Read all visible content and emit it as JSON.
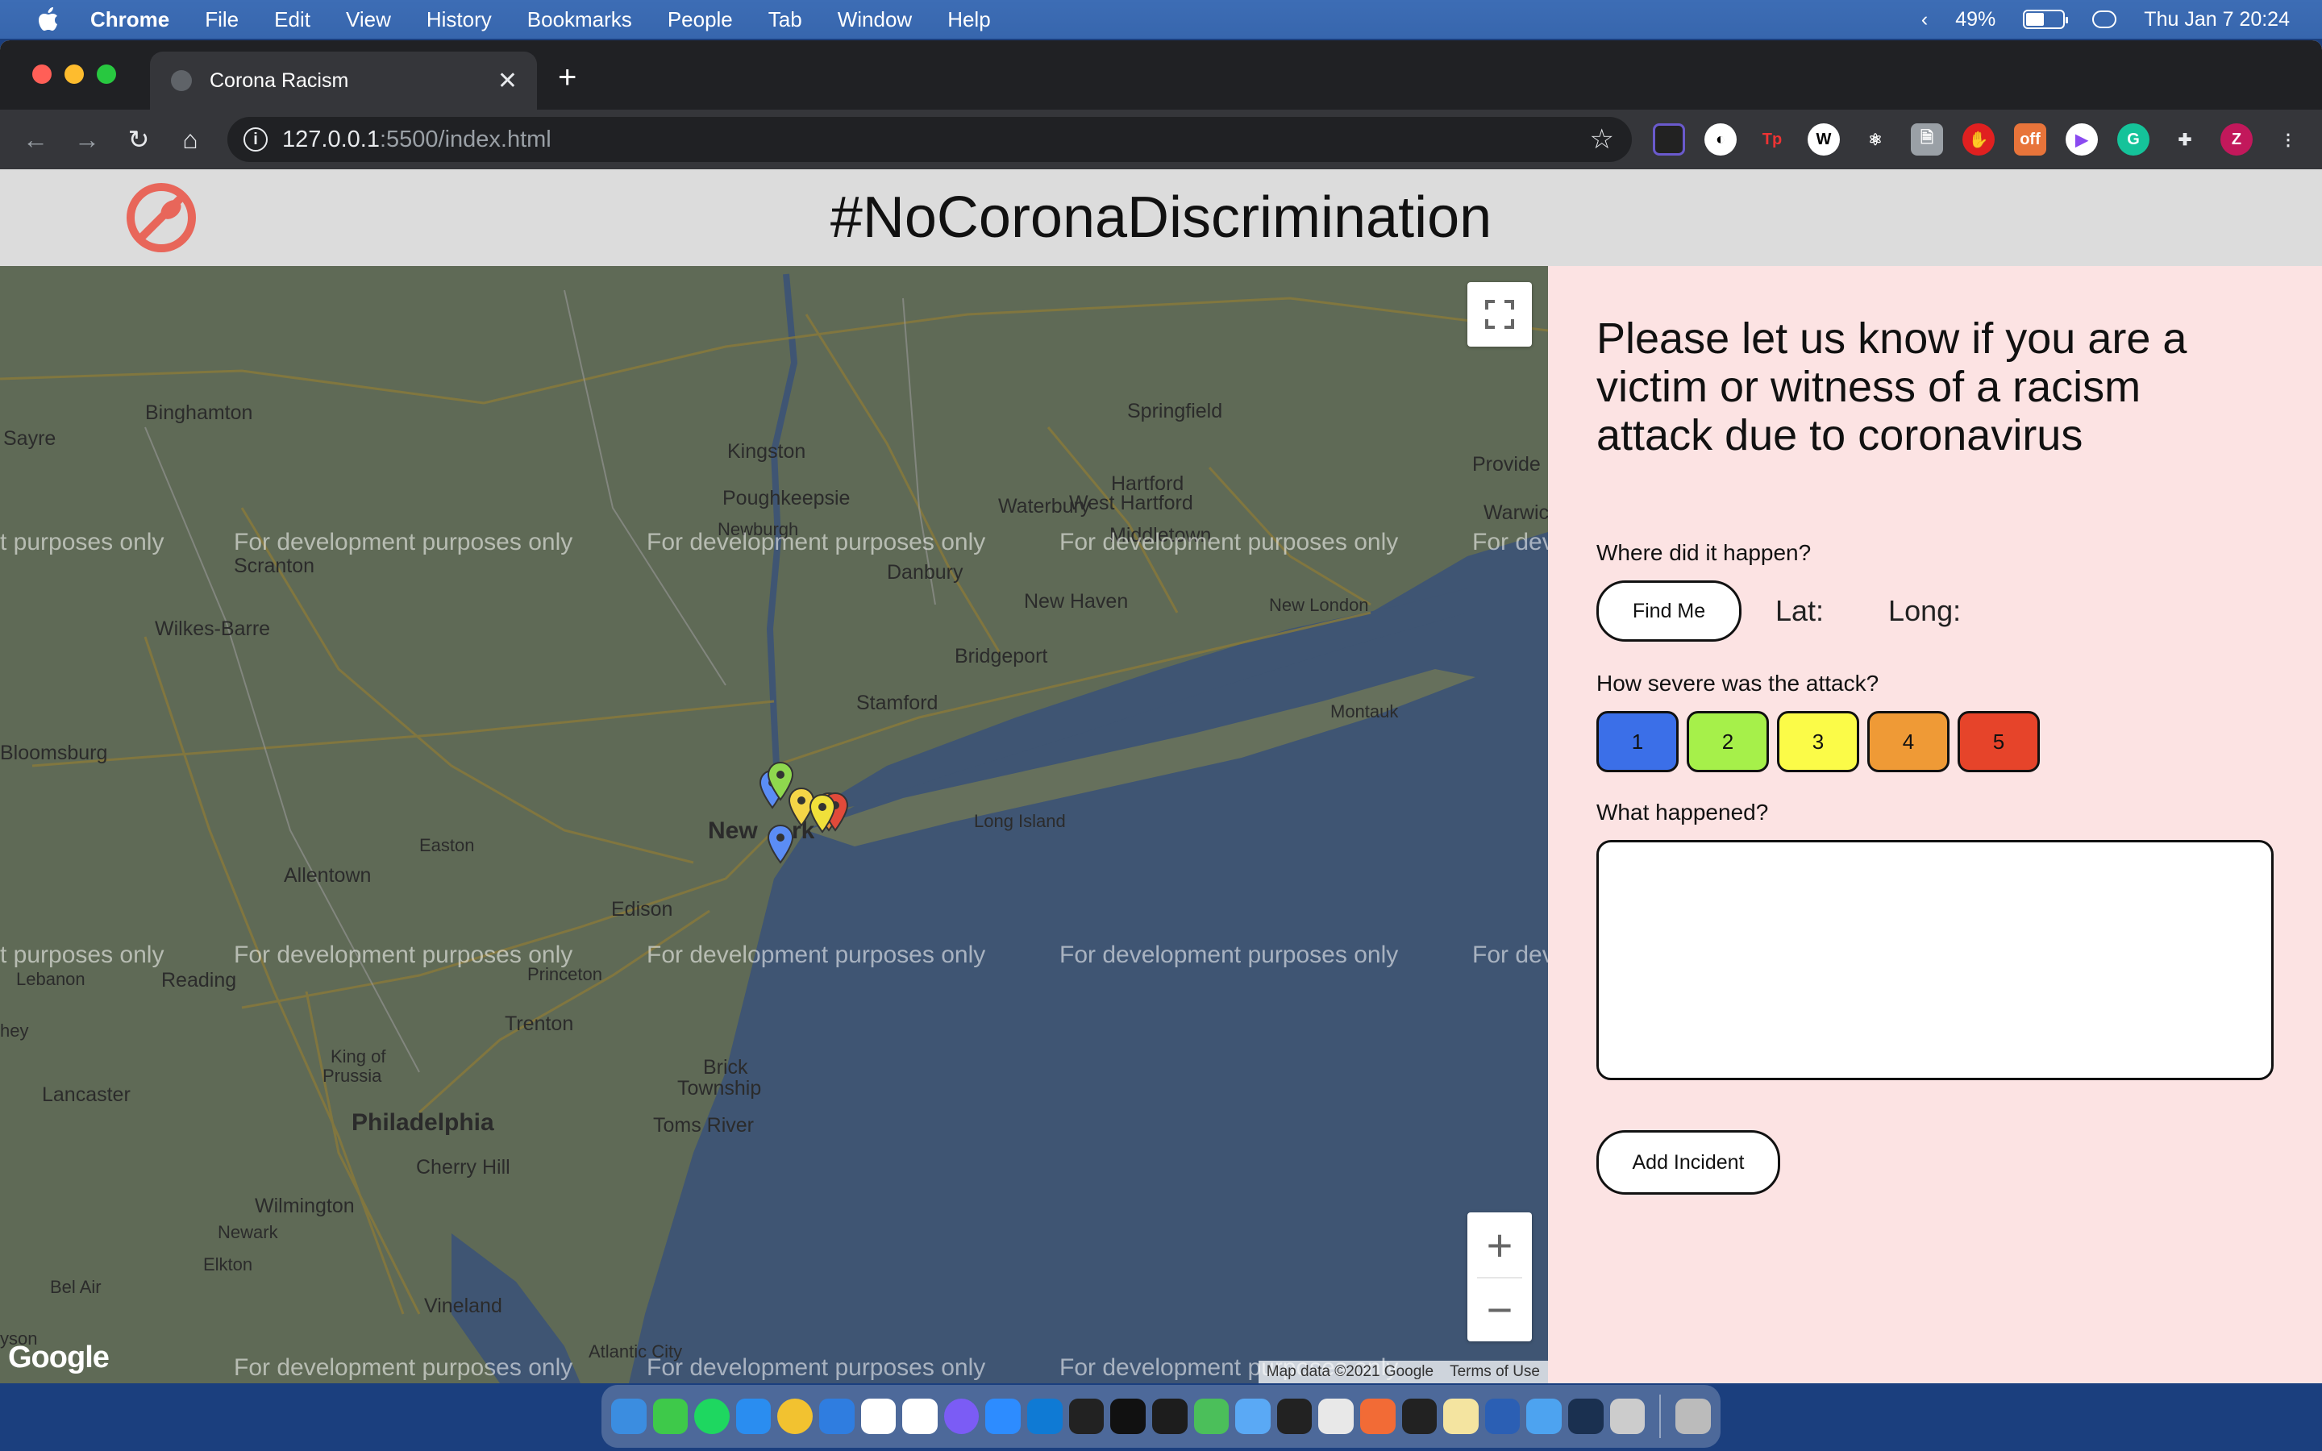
{
  "menubar": {
    "app_name": "Chrome",
    "items": [
      "File",
      "Edit",
      "View",
      "History",
      "Bookmarks",
      "People",
      "Tab",
      "Window",
      "Help"
    ],
    "battery": "49%",
    "clock": "Thu Jan 7  20:24"
  },
  "browser": {
    "tab_title": "Corona Racism",
    "url_host": "127.0.0.1",
    "url_rest": ":5500/index.html"
  },
  "header": {
    "title": "#NoCoronaDiscrimination"
  },
  "map": {
    "watermark": "For development purposes only",
    "watermark_partial_left": "t purposes only",
    "watermark_partial_right": "For dev",
    "attribution": "Map data ©2021 Google",
    "terms": "Terms of Use",
    "logo_text": "Google",
    "places": {
      "binghamton": "Binghamton",
      "sayre": "Sayre",
      "kingston": "Kingston",
      "springfield": "Springfield",
      "hartford": "Hartford",
      "west_hartford": "West Hartford",
      "providence": "Provide",
      "warwick": "Warwic",
      "poughkeepsie": "Poughkeepsie",
      "newburgh": "Newburgh",
      "waterbury": "Waterbury",
      "middletown": "Middletown",
      "scranton": "Scranton",
      "danbury": "Danbury",
      "new_haven": "New Haven",
      "new_london": "New London",
      "wilkes_barre": "Wilkes-Barre",
      "bridgeport": "Bridgeport",
      "stamford": "Stamford",
      "montauk": "Montauk",
      "bloomsburg": "Bloomsburg",
      "new_york_a": "New",
      "new_york_b": "rk",
      "long_island": "Long Island",
      "easton": "Easton",
      "allentown": "Allentown",
      "edison": "Edison",
      "lebanon": "Lebanon",
      "reading": "Reading",
      "princeton": "Princeton",
      "trenton": "Trenton",
      "king_of_prussia_1": "King of",
      "king_of_prussia_2": "Prussia",
      "brick_1": "Brick",
      "brick_2": "Township",
      "lancaster": "Lancaster",
      "philadelphia": "Philadelphia",
      "toms_river": "Toms River",
      "cherry_hill": "Cherry Hill",
      "wilmington": "Wilmington",
      "newark_de": "Newark",
      "elkton": "Elkton",
      "bel_air": "Bel Air",
      "vineland": "Vineland",
      "atlantic_city": "Atlantic City",
      "hey": "hey",
      "yson": "yson"
    },
    "pins": [
      "#5b8df5",
      "#8fd84e",
      "#f5d547",
      "#f0e03a",
      "#e8943a",
      "#e14a3a",
      "#5b8df5"
    ]
  },
  "form": {
    "heading": "Please let us know if you are a victim or witness of a racism attack due to coronavirus",
    "where_label": "Where did it happen?",
    "find_me": "Find Me",
    "lat_label": "Lat:",
    "long_label": "Long:",
    "severity_label": "How severe was the attack?",
    "severity_levels": [
      {
        "label": "1",
        "color": "#3b6fe8"
      },
      {
        "label": "2",
        "color": "#a6f04a"
      },
      {
        "label": "3",
        "color": "#fbfb48"
      },
      {
        "label": "4",
        "color": "#ef9a36"
      },
      {
        "label": "5",
        "color": "#e6442a"
      }
    ],
    "what_label": "What happened?",
    "description_value": "",
    "add_incident": "Add Incident"
  },
  "colors": {
    "panel_bg": "#fce3e3",
    "header_bg": "#dcdcdc",
    "logo_red": "#e8665a"
  }
}
